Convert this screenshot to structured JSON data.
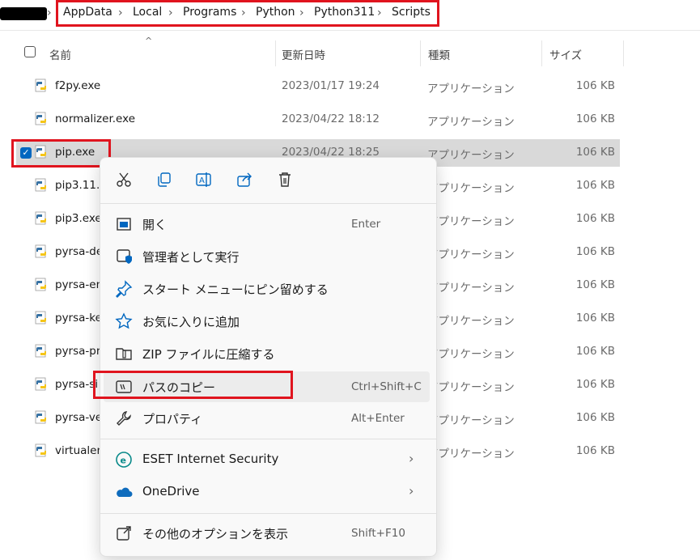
{
  "breadcrumb": {
    "items": [
      "AppData",
      "Local",
      "Programs",
      "Python",
      "Python311",
      "Scripts"
    ],
    "separator": "›"
  },
  "columns": {
    "name": "名前",
    "date": "更新日時",
    "type": "種類",
    "size": "サイズ"
  },
  "files": [
    {
      "name": "f2py.exe",
      "date": "2023/01/17 19:24",
      "type": "アプリケーション",
      "size": "106 KB"
    },
    {
      "name": "normalizer.exe",
      "date": "2023/04/22 18:12",
      "type": "アプリケーション",
      "size": "106 KB"
    },
    {
      "name": "pip.exe",
      "date": "2023/04/22 18:25",
      "type": "アプリケーション",
      "size": "106 KB",
      "selected": true
    },
    {
      "name": "pip3.11.exe",
      "date": "",
      "type": "アプリケーション",
      "size": "106 KB"
    },
    {
      "name": "pip3.exe",
      "date": "",
      "type": "アプリケーション",
      "size": "106 KB"
    },
    {
      "name": "pyrsa-decrypt.exe",
      "date": "",
      "type": "アプリケーション",
      "size": "106 KB"
    },
    {
      "name": "pyrsa-encrypt.exe",
      "date": "",
      "type": "アプリケーション",
      "size": "106 KB"
    },
    {
      "name": "pyrsa-keygen.exe",
      "date": "",
      "type": "アプリケーション",
      "size": "106 KB"
    },
    {
      "name": "pyrsa-priv2pub.exe",
      "date": "",
      "type": "アプリケーション",
      "size": "106 KB"
    },
    {
      "name": "pyrsa-sign.exe",
      "date": "",
      "type": "アプリケーション",
      "size": "106 KB"
    },
    {
      "name": "pyrsa-verify.exe",
      "date": "",
      "type": "アプリケーション",
      "size": "106 KB"
    },
    {
      "name": "virtualenv.exe",
      "date": "",
      "type": "アプリケーション",
      "size": "106 KB"
    }
  ],
  "visible_names": [
    "f2py.exe",
    "normalizer.exe",
    "pip.exe",
    "pip3.11.e",
    "pip3.exe",
    "pyrsa-de",
    "pyrsa-en",
    "pyrsa-ke",
    "pyrsa-pr",
    "pyrsa-si",
    "pyrsa-ve",
    "virtualen"
  ],
  "context_menu": {
    "quick_actions": [
      "cut-icon",
      "copy-icon",
      "rename-icon",
      "share-icon",
      "delete-icon"
    ],
    "items": [
      {
        "label": "開く",
        "shortcut": "Enter",
        "icon": "open-icon"
      },
      {
        "label": "管理者として実行",
        "shortcut": "",
        "icon": "admin-shield-icon"
      },
      {
        "label": "スタート メニューにピン留めする",
        "shortcut": "",
        "icon": "pin-icon"
      },
      {
        "label": "お気に入りに追加",
        "shortcut": "",
        "icon": "star-icon"
      },
      {
        "label": "ZIP ファイルに圧縮する",
        "shortcut": "",
        "icon": "zip-folder-icon"
      },
      {
        "label": "パスのコピー",
        "shortcut": "Ctrl+Shift+C",
        "icon": "copy-path-icon"
      },
      {
        "label": "プロパティ",
        "shortcut": "Alt+Enter",
        "icon": "wrench-icon"
      },
      {
        "label": "ESET Internet Security",
        "shortcut": "",
        "icon": "eset-icon"
      },
      {
        "label": "OneDrive",
        "shortcut": "",
        "icon": "onedrive-cloud-icon"
      },
      {
        "label": "その他のオプションを表示",
        "shortcut": "Shift+F10",
        "icon": "more-options-icon"
      }
    ]
  },
  "colors": {
    "highlight_red": "#e0141e",
    "selection_gray": "#d9d9d9",
    "accent_blue": "#0067c0"
  }
}
